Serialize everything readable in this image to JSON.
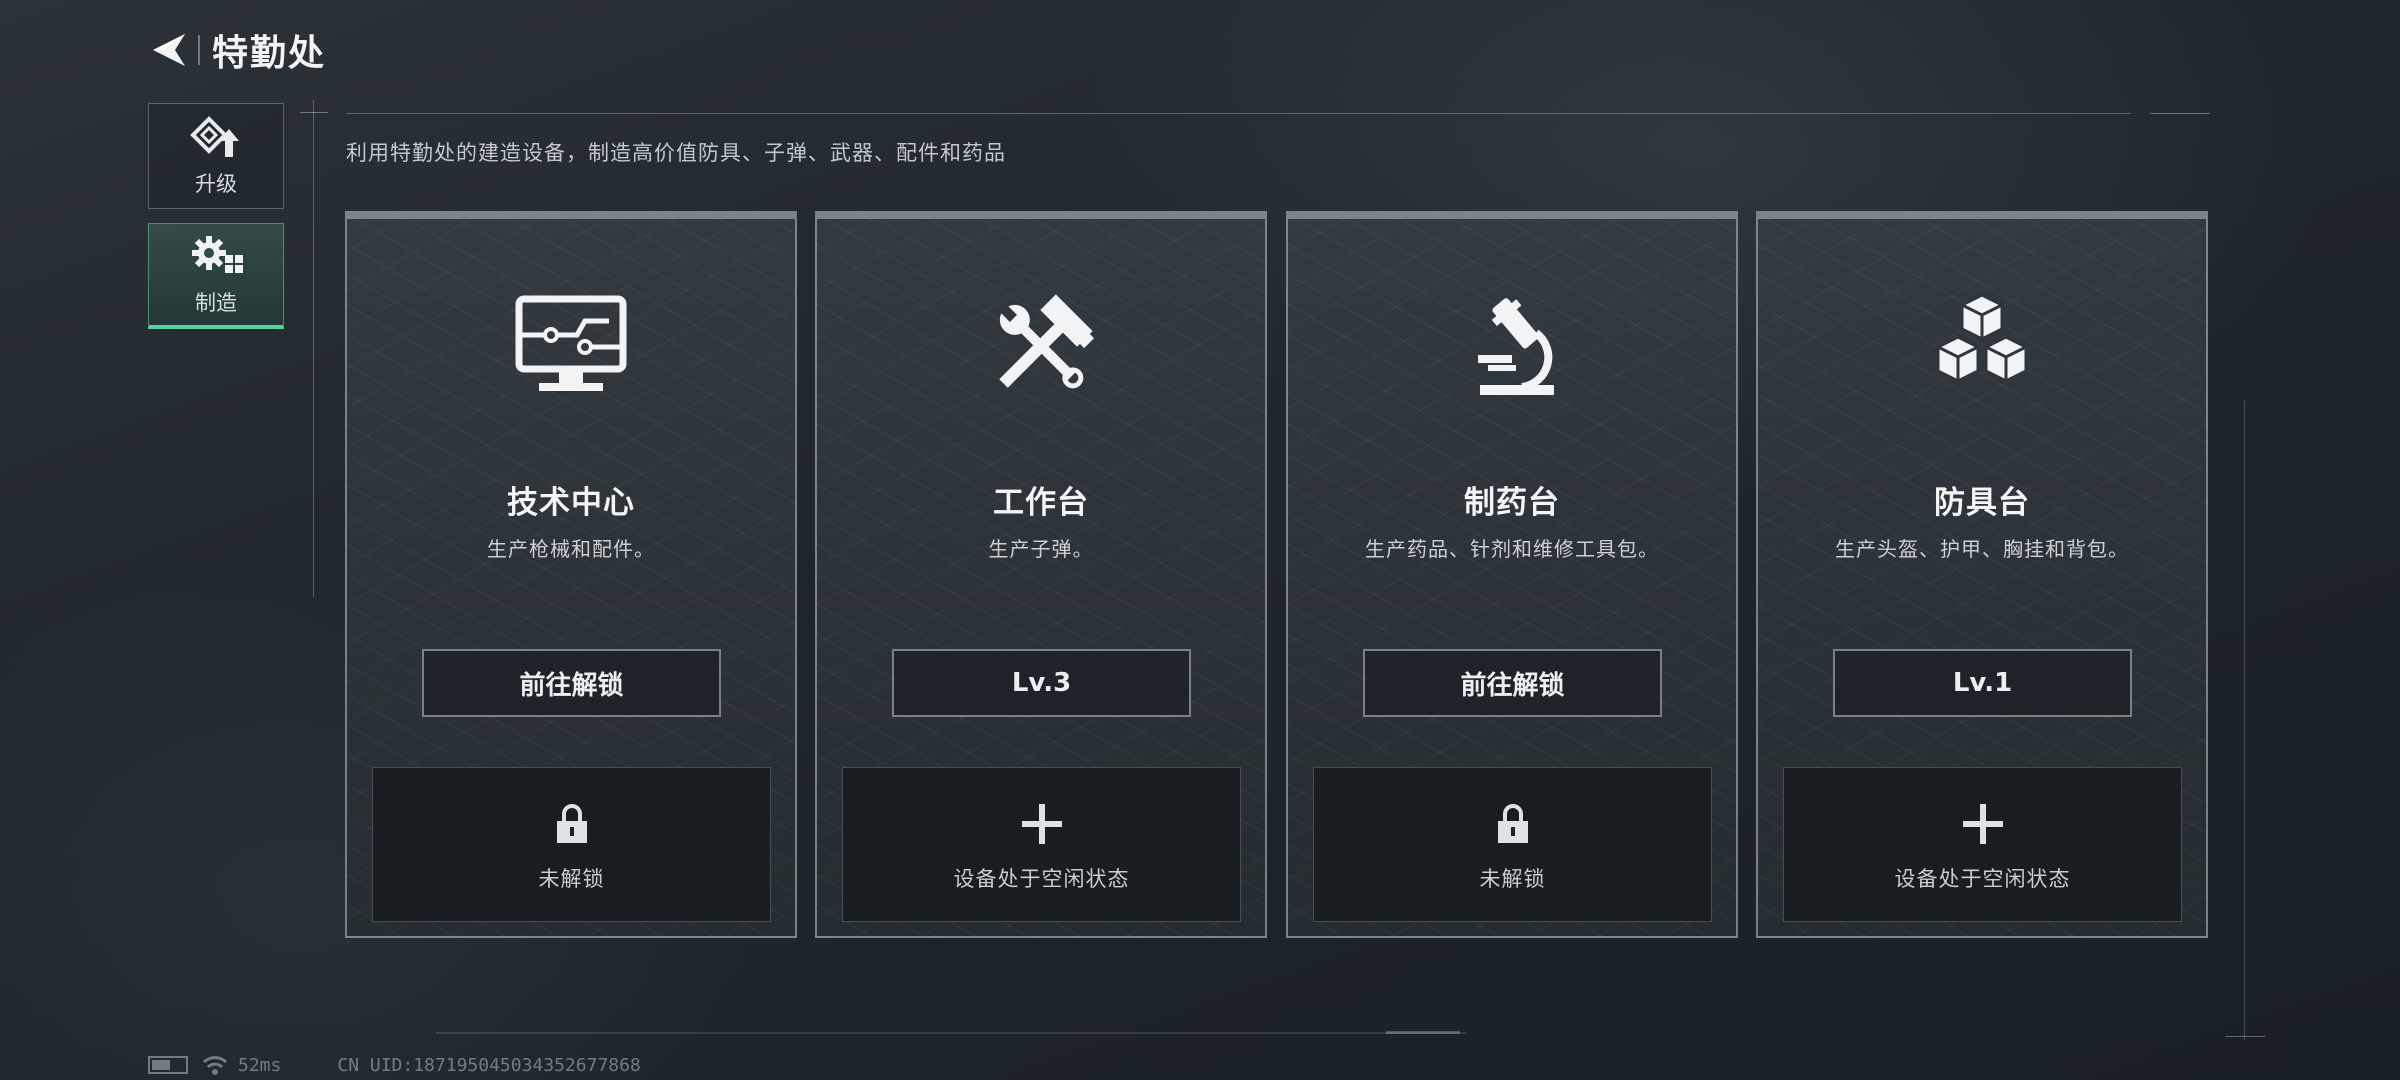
{
  "header": {
    "back_icon": "back-arrow-icon",
    "title": "特勤处"
  },
  "sidebar": {
    "items": [
      {
        "label": "升级",
        "icon": "upgrade-icon",
        "active": false
      },
      {
        "label": "制造",
        "icon": "gear-icon",
        "active": true
      }
    ]
  },
  "description": "利用特勤处的建造设备，制造高价值防具、子弹、武器、配件和药品",
  "cards": [
    {
      "title": "技术中心",
      "subtitle": "生产枪械和配件。",
      "icon": "monitor-circuit-icon",
      "button": "前往解锁",
      "slot_icon": "lock-icon",
      "slot_text": "未解锁"
    },
    {
      "title": "工作台",
      "subtitle": "生产子弹。",
      "icon": "hammer-wrench-icon",
      "button": "Lv.3",
      "slot_icon": "plus-icon",
      "slot_text": "设备处于空闲状态"
    },
    {
      "title": "制药台",
      "subtitle": "生产药品、针剂和维修工具包。",
      "icon": "microscope-icon",
      "button": "前往解锁",
      "slot_icon": "lock-icon",
      "slot_text": "未解锁"
    },
    {
      "title": "防具台",
      "subtitle": "生产头盔、护甲、胸挂和背包。",
      "icon": "cubes-icon",
      "button": "Lv.1",
      "slot_icon": "plus-icon",
      "slot_text": "设备处于空闲状态"
    }
  ],
  "footer": {
    "ping": "52ms",
    "uid": "CN UID:187195045034352677868"
  },
  "colors": {
    "accent": "#59d1a3",
    "background": "#1f262c"
  }
}
